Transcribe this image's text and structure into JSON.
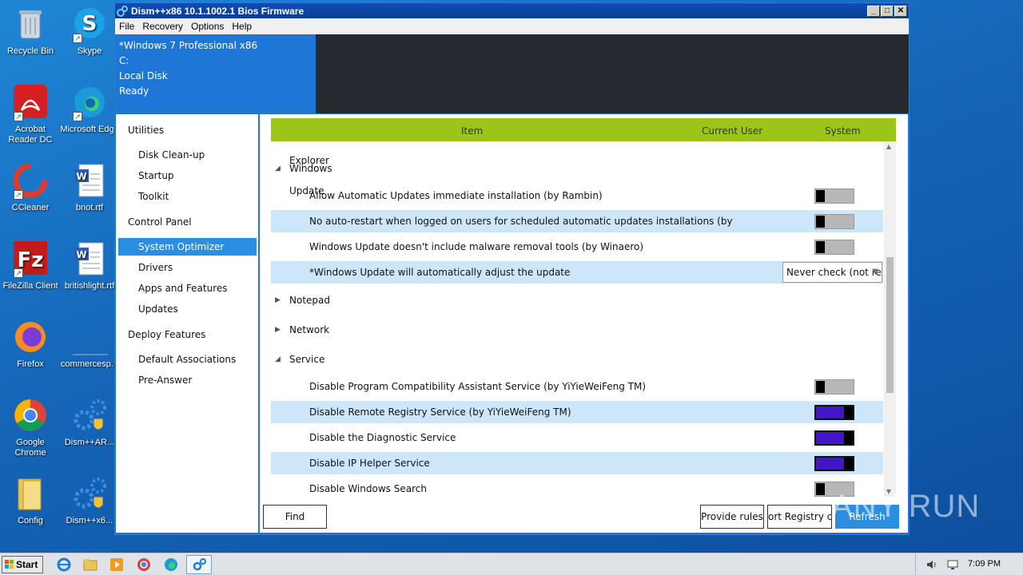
{
  "desktop": {
    "icons": [
      {
        "label": "Recycle Bin",
        "icon": "recycle-bin-icon"
      },
      {
        "label": "Skype",
        "icon": "skype-icon"
      },
      {
        "label": "Acrobat Reader DC",
        "icon": "acrobat-icon"
      },
      {
        "label": "Microsoft Edge",
        "icon": "edge-icon"
      },
      {
        "label": "CCleaner",
        "icon": "ccleaner-icon"
      },
      {
        "label": "bnot.rtf",
        "icon": "word-doc-icon"
      },
      {
        "label": "FileZilla Client",
        "icon": "filezilla-icon"
      },
      {
        "label": "britishlight.rtf",
        "icon": "word-doc-icon"
      },
      {
        "label": "Firefox",
        "icon": "firefox-icon"
      },
      {
        "label": "commercesp...",
        "icon": "blank-file-icon"
      },
      {
        "label": "Google Chrome",
        "icon": "chrome-icon"
      },
      {
        "label": "Dism++AR...",
        "icon": "dism-gear-icon"
      },
      {
        "label": "Config",
        "icon": "folder-icon"
      },
      {
        "label": "Dism++x6...",
        "icon": "dism-gear-icon"
      }
    ]
  },
  "window": {
    "title": "Dism++x86 10.1.1002.1 Bios Firmware",
    "menu": [
      "File",
      "Recovery",
      "Options",
      "Help"
    ],
    "header_info": [
      "*Windows 7 Professional x86",
      "C:",
      "Local Disk",
      "Ready"
    ],
    "sidebar": {
      "utilities": "Utilities",
      "disk_cleanup": "Disk Clean-up",
      "startup": "Startup",
      "toolkit": "Toolkit",
      "control_panel": "Control Panel",
      "system_optimizer": "System Optimizer",
      "drivers": "Drivers",
      "apps_features": "Apps and Features",
      "updates": "Updates",
      "deploy_features": "Deploy Features",
      "default_assoc": "Default Associations",
      "pre_answer": "Pre-Answer"
    },
    "grid": {
      "col_item": "Item",
      "col_current_user": "Current User",
      "col_system": "System",
      "partial_group": "Internet Explorer",
      "groups": {
        "windows_update": "Windows Update",
        "notepad": "Notepad",
        "network": "Network",
        "service": "Service"
      },
      "rows": [
        {
          "label": "Allow Automatic Updates immediate installation (by Rambin)",
          "state": "off"
        },
        {
          "label": "No auto-restart when logged on users for scheduled automatic updates installations (by",
          "state": "off"
        },
        {
          "label": "Windows Update doesn't include malware removal tools (by Winaero)",
          "state": "off"
        },
        {
          "label": "*Windows Update will automatically adjust the update",
          "combo": "Never check (not re"
        },
        {
          "label": "Disable Program Compatibility Assistant Service (by YiYieWeiFeng TM)",
          "state": "off"
        },
        {
          "label": "Disable Remote Registry Service (by YiYieWeiFeng TM)",
          "state": "on"
        },
        {
          "label": "Disable the Diagnostic Service",
          "state": "on"
        },
        {
          "label": "Disable IP Helper Service",
          "state": "on"
        },
        {
          "label": "Disable Windows Search",
          "state": "off"
        }
      ]
    },
    "buttons": {
      "find": "Find",
      "provide_rules": "Provide rules",
      "export_registry": "ort Registry co",
      "refresh": "Refresh"
    }
  },
  "taskbar": {
    "start": "Start",
    "clock": "7:09 PM"
  },
  "watermark": "ANY RUN",
  "colors": {
    "accent": "#1e77d6",
    "grid_header": "#9cc51a",
    "toggle_on": "#4016c8",
    "highlight_row": "#cde6fa"
  }
}
